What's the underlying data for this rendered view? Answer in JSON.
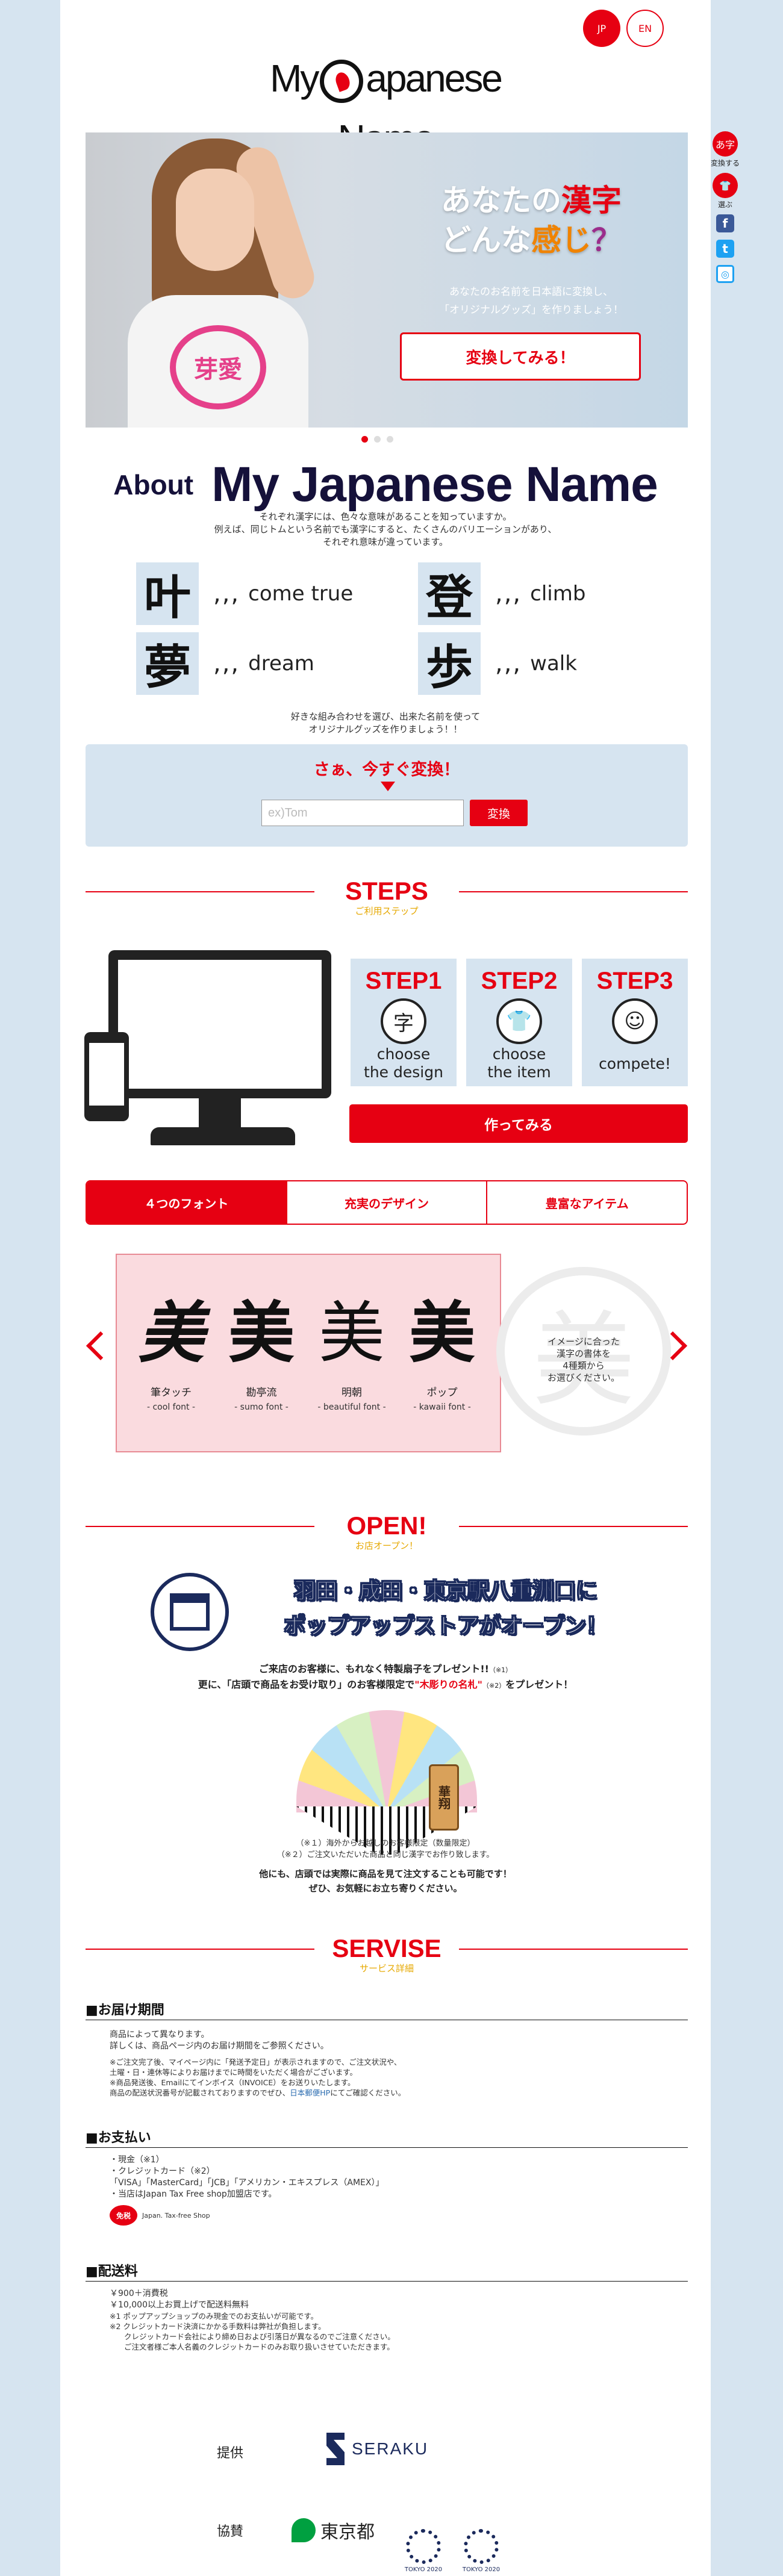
{
  "header": {
    "lang_jp": "JP",
    "lang_en": "EN",
    "logo_prefix": "My",
    "logo_suffix": "apanese Name"
  },
  "float_menu": {
    "convert_label": "変換する",
    "choose_label": "選ぶ",
    "convert_badge": "あ字",
    "icons": [
      "convert-icon",
      "tshirt-icon",
      "facebook-icon",
      "twitter-icon",
      "instagram-icon"
    ]
  },
  "hero": {
    "title_pre1": "あなたの",
    "title_red": "漢字",
    "title_line2_pre": "どんな",
    "title_orange": "感じ",
    "title_q": "？",
    "sub1": "あなたのお名前を日本語に変換し、",
    "sub2": "「オリジナルグッズ」を作りましょう！",
    "button": "変換してみる！",
    "shirt_print": "芽愛"
  },
  "about": {
    "small": "About",
    "big": "My Japanese Name",
    "desc1": "それぞれ漢字には、色々な意味があることを知っていますか。",
    "desc2": "例えば、同じトムという名前でも漢字にすると、たくさんのバリエーションがあり、",
    "desc3": "それぞれ意味が違っています。",
    "kanji": [
      {
        "k": "叶",
        "dots": ",,,",
        "w": "come true"
      },
      {
        "k": "登",
        "dots": ",,,",
        "w": "climb"
      },
      {
        "k": "夢",
        "dots": ",,,",
        "w": "dream"
      },
      {
        "k": "歩",
        "dots": ",,,",
        "w": "walk"
      }
    ],
    "foot1": "好きな組み合わせを選び、出来た名前を使って",
    "foot2": "オリジナルグッズを作りましょう！！"
  },
  "convert": {
    "title": "さぁ、今すぐ変換！",
    "placeholder": "ex)Tom",
    "button": "変換"
  },
  "steps": {
    "title": "STEPS",
    "subtitle": "ご利用ステップ",
    "items": [
      {
        "head": "STEP1",
        "label1": "choose",
        "label2": "the design"
      },
      {
        "head": "STEP2",
        "label1": "choose",
        "label2": "the item"
      },
      {
        "head": "STEP3",
        "label1": "compete!",
        "label2": ""
      }
    ],
    "button": "作ってみる"
  },
  "tabs": [
    "４つのフォント",
    "充実のデザイン",
    "豊富なアイテム"
  ],
  "fonts": {
    "items": [
      {
        "k": "美",
        "name": "筆タッチ",
        "en": "- cool font -"
      },
      {
        "k": "美",
        "name": "勘亭流",
        "en": "- sumo font -"
      },
      {
        "k": "美",
        "name": "明朝",
        "en": "- beautiful font -"
      },
      {
        "k": "美",
        "name": "ポップ",
        "en": "- kawaii font -"
      }
    ],
    "ghost_kanji": "美",
    "side1": "イメージに合った",
    "side2": "漢字の書体を",
    "side3": "4種類から",
    "side4": "お選びください。"
  },
  "open": {
    "title": "OPEN!",
    "subtitle": "お店オープン！",
    "headline1": "羽田・成田・東京駅八重洲口に",
    "headline2": "ポップアップストアがオープン！",
    "p1_pre": "ご来店のお客様に、もれなく特製扇子をプレゼント!!",
    "p1_note": "（※1）",
    "p2_pre": "更に、「店頭で商品をお受け取り」のお客様限定で",
    "p2_red": "\"木彫りの名札\"",
    "p2_note": "（※2）",
    "p2_post": "をプレゼント！",
    "tag_text": "華翔",
    "note1": "（※１）海外からお越しのお客様限定（数量限定）",
    "note2": "（※２）ご注文いただいた商品と同じ漢字でお作り致します。",
    "tail1": "他にも、店頭では実際に商品を見て注文することも可能です！",
    "tail2": "ぜひ、お気軽にお立ち寄りください。"
  },
  "service": {
    "title": "SERVISE",
    "subtitle": "サービス詳細",
    "delivery": {
      "heading": "■お届け期間",
      "l1": "商品によって異なります。",
      "l2": "詳しくは、商品ページ内のお届け期間をご参照ください。",
      "n1": "※ご注文完了後、マイページ内に「発送予定日」が表示されますので、ご注文状況や、",
      "n2": "土曜・日・連休等によりお届けまでに時間をいただく場合がございます。",
      "n3": "※商品発送後、Emailにてインボイス（INVOICE）をお送りいたします。",
      "n4_pre": "商品の配送状況番号が記載されておりますのでぜひ、",
      "n4_link": "日本郵便HP",
      "n4_post": "にてご確認ください。"
    },
    "payment": {
      "heading": "■お支払い",
      "l1": "・現金（※1）",
      "l2": "・クレジットカード（※2）",
      "l3": "「VISA」「MasterCard」「JCB」「アメリカン・エキスプレス（AMEX）」",
      "l4": "・当店はJapan Tax Free shop加盟店です。",
      "tax_mark": "免税",
      "tax_label": "Japan. Tax-free Shop"
    },
    "shipping": {
      "heading": "■配送料",
      "l1": "￥900＋消費税",
      "l2": "￥10,000以上お買上げで配送料無料",
      "n1": "※1 ポップアップショップのみ現金でのお支払いが可能です。",
      "n2": "※2 クレジットカード決済にかかる手数料は弊社が負担します。",
      "n3": "クレジットカード会社により締め日および引落日が異なるのでご注意ください。",
      "n4": "ご注文者様ご本人名義のクレジットカードのみお取り扱いさせていただきます。"
    }
  },
  "footer": {
    "provided_label": "提供",
    "provider": "SERAKU",
    "sponsor_label": "協賛",
    "tokyo": "東京都",
    "emblem1": "TOKYO 2020",
    "emblem2": "TOKYO 2020"
  }
}
